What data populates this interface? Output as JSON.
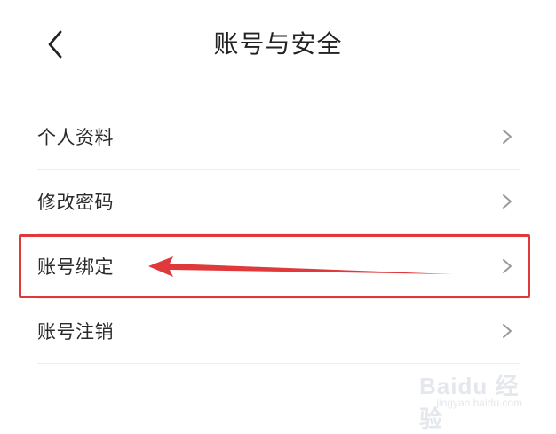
{
  "header": {
    "title": "账号与安全",
    "back_icon": "chevron-left-icon"
  },
  "menu": {
    "items": [
      {
        "label": "个人资料",
        "icon": "chevron-right-icon"
      },
      {
        "label": "修改密码",
        "icon": "chevron-right-icon"
      },
      {
        "label": "账号绑定",
        "icon": "chevron-right-icon"
      },
      {
        "label": "账号注销",
        "icon": "chevron-right-icon"
      }
    ]
  },
  "annotation": {
    "highlighted_item": "账号绑定",
    "color": "#e0393b"
  },
  "watermark": {
    "main": "Baidu 经验",
    "sub": "jingyan.baidu.com"
  },
  "colors": {
    "text": "#222222",
    "chevron": "#9a9a9a",
    "divider": "#eeeeee",
    "annotation": "#e0393b"
  }
}
